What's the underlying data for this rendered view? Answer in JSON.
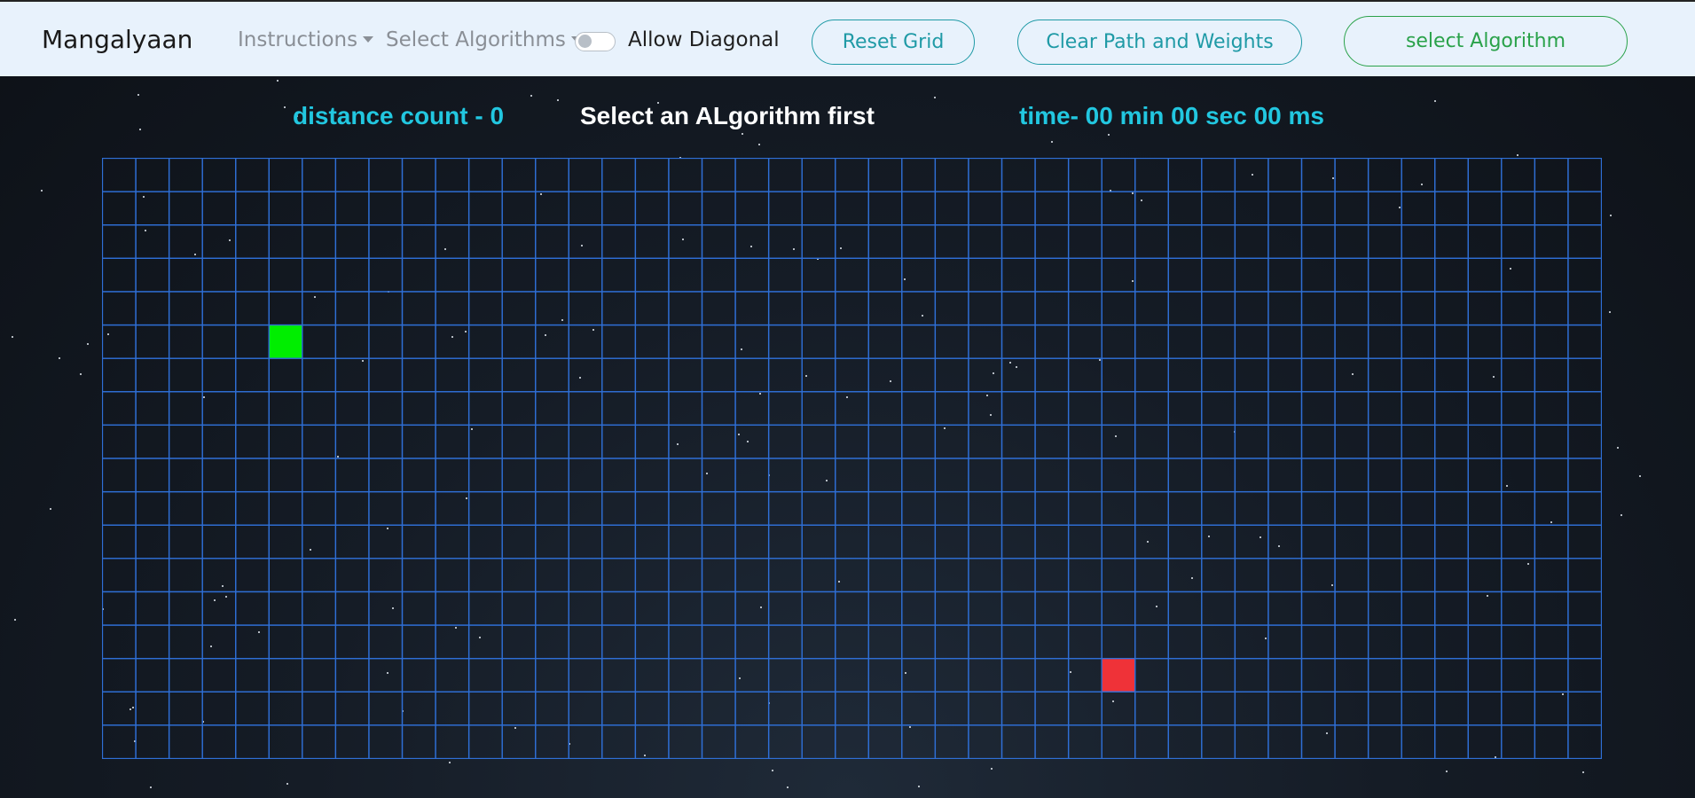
{
  "navbar": {
    "brand": "Mangalyaan",
    "instructions_label": "Instructions",
    "algorithms_label": "Select Algorithms",
    "allow_diagonal_label": "Allow Diagonal",
    "allow_diagonal_on": false,
    "reset_grid_label": "Reset Grid",
    "clear_path_label": "Clear Path and Weights",
    "select_algorithm_label": "select Algorithm"
  },
  "stats": {
    "distance": "distance count - 0",
    "status": "Select an ALgorithm first",
    "time": "time- 00 min 00 sec 00 ms"
  },
  "grid": {
    "cols": 45,
    "rows": 18,
    "start": {
      "row": 5,
      "col": 5
    },
    "end": {
      "row": 15,
      "col": 30
    },
    "line_color": "#2f6fd6",
    "start_color": "#00ee00",
    "end_color": "#ef3238"
  },
  "colors": {
    "navbar_bg": "#e8f2fc",
    "accent_teal": "#1f9aa6",
    "accent_green": "#2aa24a",
    "stat_cyan": "#22c7e0"
  }
}
